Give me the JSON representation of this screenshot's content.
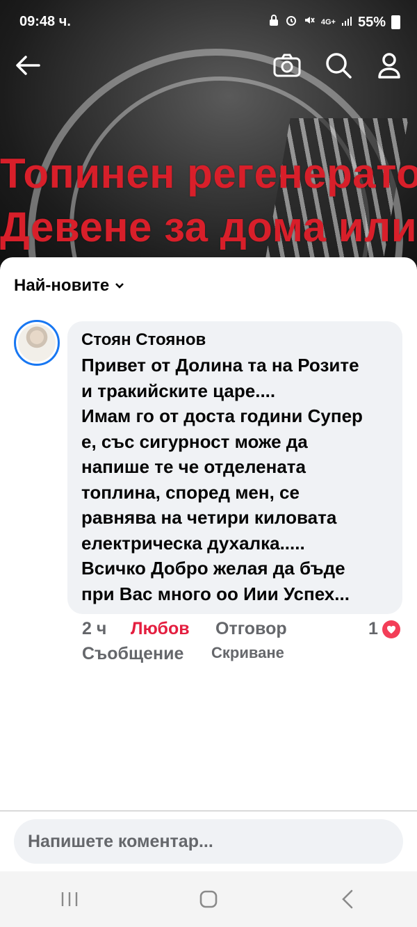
{
  "status_bar": {
    "time": "09:48 ч.",
    "network": "4G+",
    "battery": "55%"
  },
  "video": {
    "overlay_line1": "Топинен регенератор",
    "overlay_line2": "Девене за дома или"
  },
  "topbar": {
    "back_icon": "arrow-left-icon",
    "camera_icon": "camera-icon",
    "search_icon": "search-icon",
    "profile_icon": "profile-icon"
  },
  "comments": {
    "sort_label": "Най-новите",
    "items": [
      {
        "author": "Стоян Стоянов",
        "text": "Привет от Долина та на Розите\nи тракийските царе....\nИмам го от доста години Супер\nе, със сигурност може да\nнапише те че отделената\nтоплина, според мен, се\nравнява на четири киловата\nелектрическа духалка.....\nВсичко Добро желая да бъде\nпри Вас много оо Иии Успех...",
        "time": "2 ч",
        "reaction_label": "Любов",
        "reply_label": "Отговор",
        "reaction_count": "1",
        "message_label": "Съобщение",
        "hide_label": "Скриване"
      }
    ]
  },
  "composer": {
    "placeholder": "Напишете коментар..."
  },
  "colors": {
    "accent": "#1877f2",
    "love": "#f33e58",
    "overlay_red": "#d81f2a",
    "secondary_text": "#65676b"
  }
}
